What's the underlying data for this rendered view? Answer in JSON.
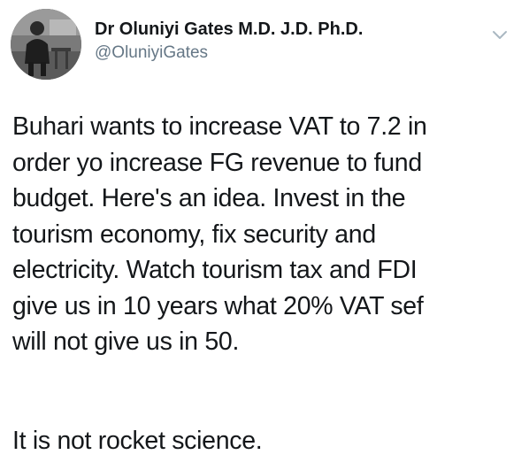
{
  "author": {
    "display_name": "Dr Oluniyi Gates M.D. J.D. Ph.D.",
    "handle": "@OluniyiGates"
  },
  "tweet": {
    "lines": [
      "Buhari wants to increase VAT to 7.2 in",
      "order yo increase FG revenue to fund",
      "budget. Here's an idea. Invest in the",
      "tourism economy, fix security and",
      "electricity. Watch tourism tax and FDI",
      "give us in 10 years what 20% VAT sef",
      "will not give us in 50."
    ],
    "second_paragraph": "It is not rocket science."
  },
  "icons": {
    "menu": "chevron-down-icon",
    "avatar": "avatar"
  },
  "colors": {
    "text": "#14171a",
    "secondary": "#657786",
    "chevron": "#aab8c2"
  }
}
